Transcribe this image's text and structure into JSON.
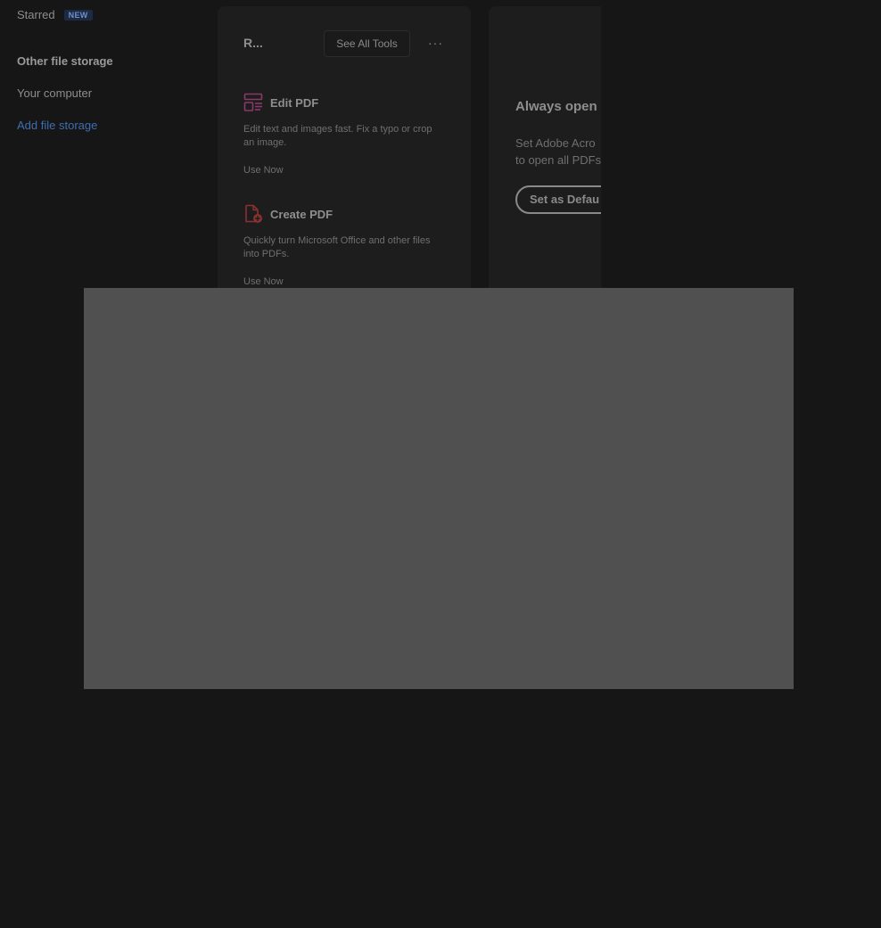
{
  "sidebar": {
    "starred_label": "Starred",
    "starred_badge": "NEW",
    "other_storage_heading": "Other file storage",
    "your_computer_label": "Your computer",
    "add_storage_label": "Add file storage"
  },
  "tools_card": {
    "title": "R...",
    "see_all_label": "See All Tools",
    "more_label": "···",
    "tools": [
      {
        "name": "Edit PDF",
        "icon": "edit-pdf-icon",
        "description": "Edit text and images fast. Fix a typo or crop an image.",
        "action": "Use Now"
      },
      {
        "name": "Create PDF",
        "icon": "create-pdf-icon",
        "description": "Quickly turn Microsoft Office and other files into PDFs.",
        "action": "Use Now"
      }
    ]
  },
  "default_card": {
    "title": "Always open",
    "description_line1": "Set Adobe Acro",
    "description_line2": "to open all PDFs",
    "button_label": "Set as Defau"
  },
  "colors": {
    "background": "#161616",
    "card": "#1d1d1d",
    "link": "#3f6eb0",
    "overlay": "#505050",
    "edit_icon": "#8a3a6a",
    "create_icon": "#8a3030"
  }
}
